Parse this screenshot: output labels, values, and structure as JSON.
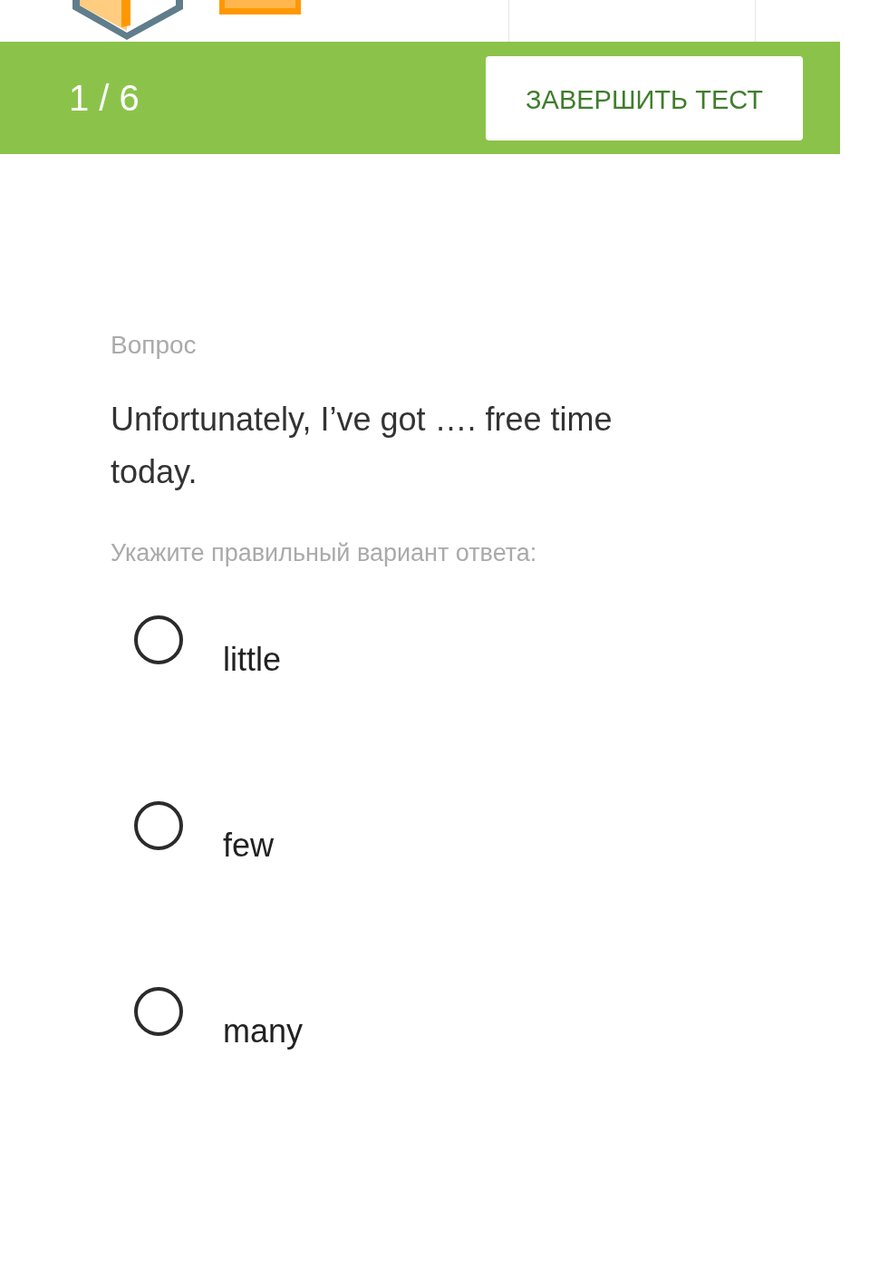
{
  "progress": {
    "counter": "1 / 6",
    "finish_button": "ЗАВЕРШИТЬ ТЕСТ"
  },
  "question": {
    "label": "Вопрос",
    "text": "Unfortunately, I’ve got …. free time today.",
    "hint": "Укажите правильный вариант ответа:"
  },
  "options": [
    {
      "label": "little",
      "selected": false
    },
    {
      "label": "few",
      "selected": false
    },
    {
      "label": "many",
      "selected": false
    }
  ]
}
